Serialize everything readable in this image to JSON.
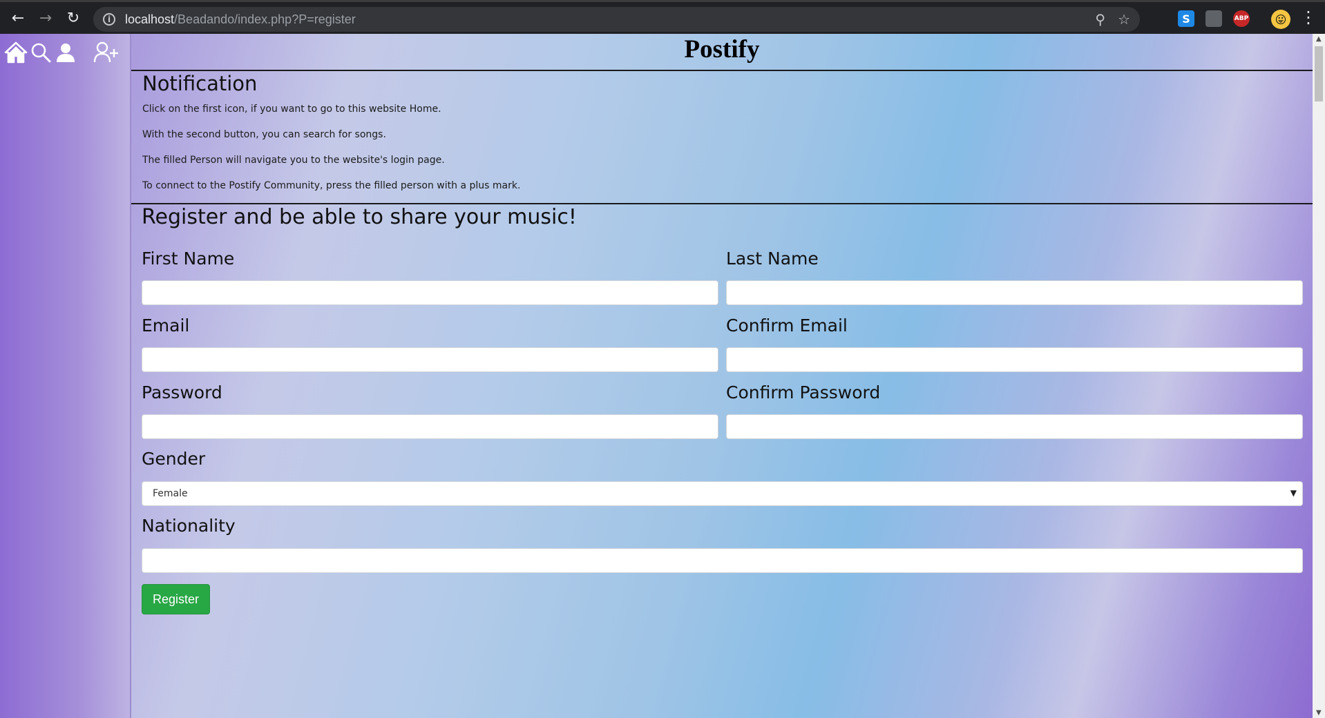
{
  "browser": {
    "url_host": "localhost",
    "url_path": "/Beadando/index.php?P=register",
    "ext_s_label": "S",
    "ext_abp_label": "ABP"
  },
  "site": {
    "title": "Postify"
  },
  "sidebar": {
    "icons": [
      "home-icon",
      "search-icon",
      "person-icon",
      "person-plus-icon"
    ]
  },
  "notification": {
    "title": "Notification",
    "lines": [
      "Click on the first icon, if you want to go to this website Home.",
      "With the second button, you can search for songs.",
      "The filled Person will navigate you to the website's login page.",
      "To connect to the Postify Community, press the filled person with a plus mark."
    ]
  },
  "register": {
    "title": "Register and be able to share your music!",
    "fields": {
      "first_name": {
        "label": "First Name",
        "value": ""
      },
      "last_name": {
        "label": "Last Name",
        "value": ""
      },
      "email": {
        "label": "Email",
        "value": ""
      },
      "confirm_email": {
        "label": "Confirm Email",
        "value": ""
      },
      "password": {
        "label": "Password",
        "value": ""
      },
      "confirm_password": {
        "label": "Confirm Password",
        "value": ""
      },
      "gender": {
        "label": "Gender",
        "value": "Female"
      },
      "nationality": {
        "label": "Nationality",
        "value": ""
      }
    },
    "submit_label": "Register"
  },
  "colors": {
    "register_button": "#28a745",
    "sidebar": "#8d6cd3"
  }
}
